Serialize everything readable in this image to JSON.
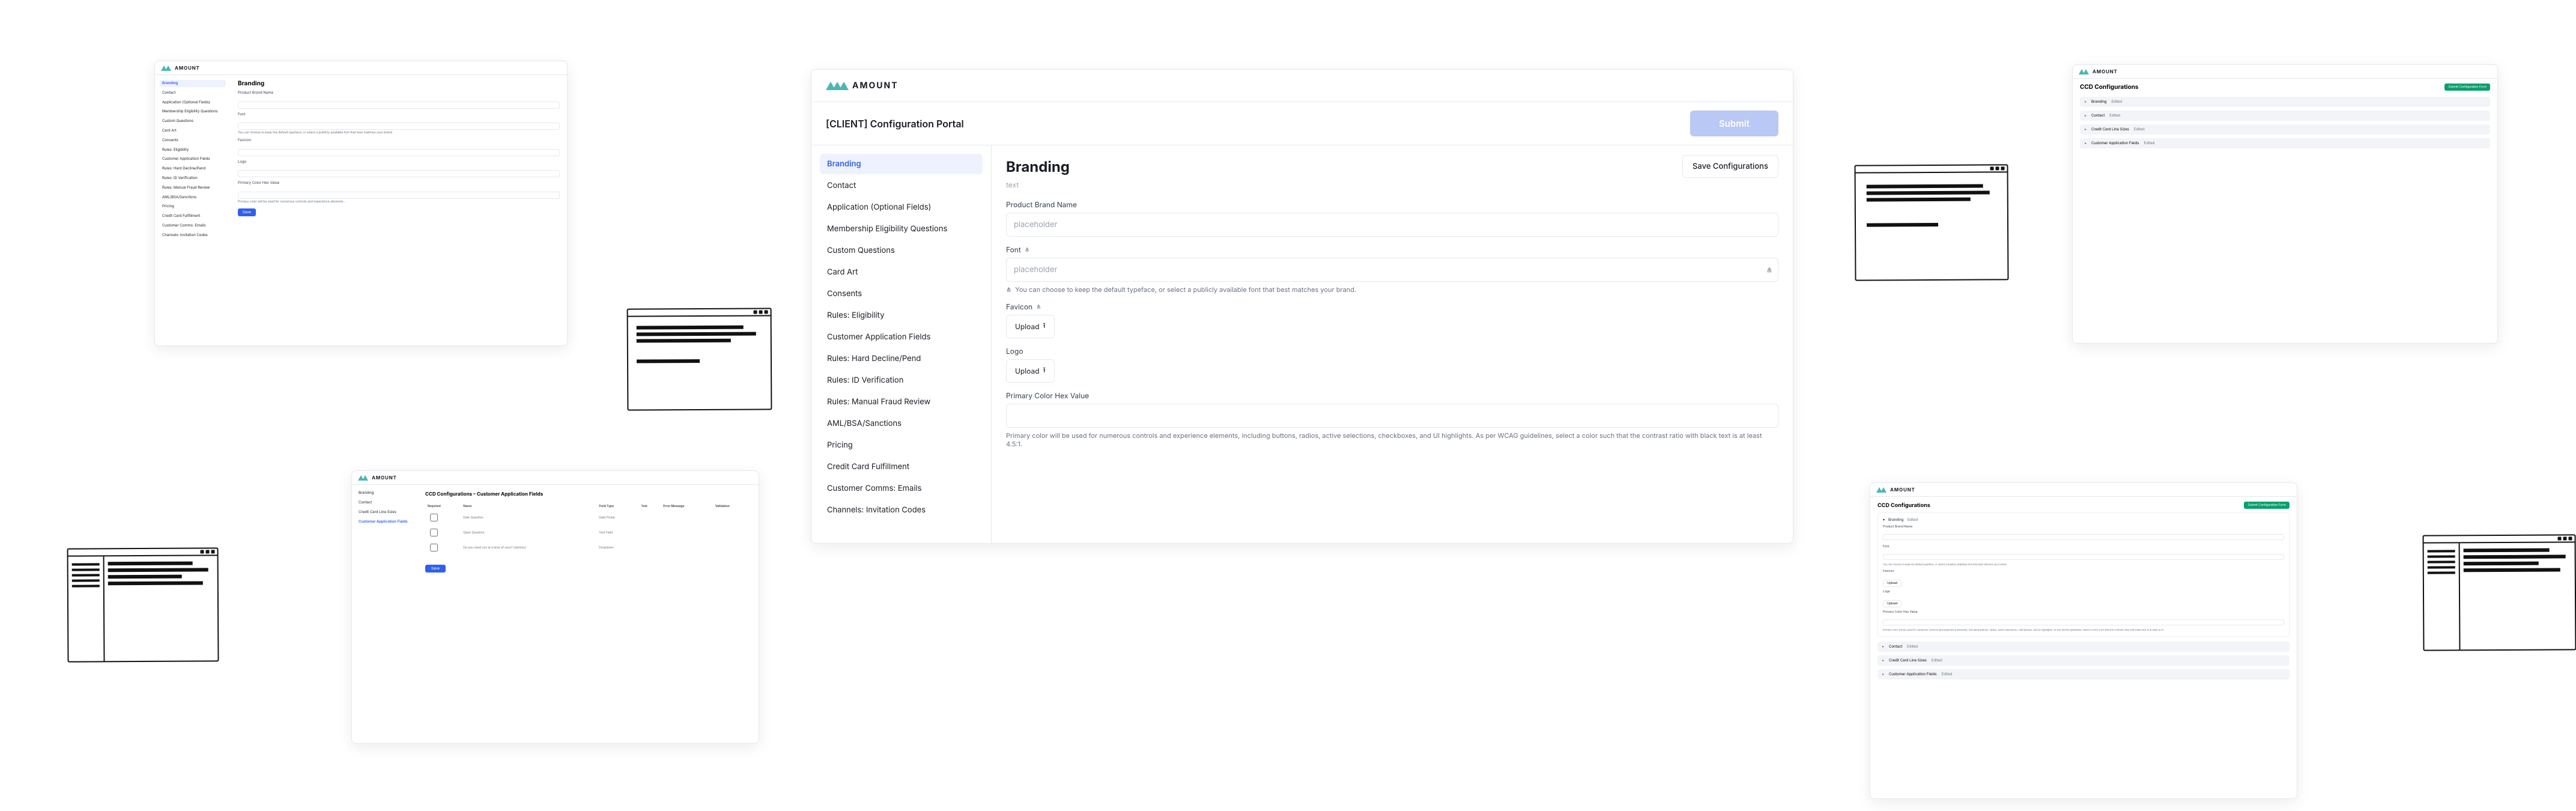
{
  "brand": "AMOUNT",
  "big": {
    "portal_title": "[CLIENT] Configuration Portal",
    "submit": "Submit",
    "nav": [
      "Branding",
      "Contact",
      "Application (Optional Fields)",
      "Membership Eligibility Questions",
      "Custom Questions",
      "Card Art",
      "Consents",
      "Rules: Eligibility",
      "Customer Application Fields",
      "Rules: Hard Decline/Pend",
      "Rules: ID Verification",
      "Rules: Manual Fraud Review",
      "AML/BSA/Sanctions",
      "Pricing",
      "Credit Card Fulfillment",
      "Customer Comms: Emails",
      "Channels: Invitation Codes"
    ],
    "section": {
      "heading": "Branding",
      "sub": "text",
      "save": "Save Configurations",
      "productBrand": {
        "label": "Product Brand Name",
        "placeholder": "placeholder"
      },
      "font": {
        "label": "Font",
        "placeholder": "placeholder",
        "hint": "You can choose to keep the default typeface, or select a publicly available font that best matches your brand."
      },
      "favicon": {
        "label": "Favicon",
        "upload": "Upload"
      },
      "logo": {
        "label": "Logo",
        "upload": "Upload"
      },
      "primary": {
        "label": "Primary Color Hex Value",
        "hint": "Primary color will be used for numerous controls and experience elements, including buttons, radios, active selections, checkboxes, and UI highlights. As per WCAG guidelines, select a color such that the contrast ratio with black text is at least 4.5:1."
      }
    }
  },
  "a": {
    "nav": [
      "Branding",
      "Contact",
      "Application (Optional Fields)",
      "Membership Eligibility Questions",
      "Custom Questions",
      "Card Art",
      "Consents",
      "Rules: Eligibility",
      "Customer Application Fields",
      "Rules: Hard Decline/Pend",
      "Rules: ID Verification",
      "Rules: Manual Fraud Review",
      "AML/BSA/Sanctions",
      "Pricing",
      "Credit Card Fulfillment",
      "Customer Comms: Emails",
      "Channels: Invitation Codes"
    ],
    "heading": "Branding",
    "labels": {
      "productBrand": "Product Brand Name",
      "font": "Font",
      "favicon": "Favicon",
      "logo": "Logo",
      "primary": "Primary Color Hex Value"
    },
    "save": "Save"
  },
  "b": {
    "nav": [
      "Branding",
      "Contact",
      "Credit Card Line Sizes",
      "Customer Application Fields"
    ],
    "title": "CCD Configurations – Customer Application Fields",
    "cols": [
      "Required",
      "Name",
      "Field Type",
      "Test",
      "Error Message",
      "Validation"
    ],
    "rows": [
      {
        "name": "Date Question",
        "type": "Date Picker"
      },
      {
        "name": "Open Question",
        "type": "Text Field"
      },
      {
        "name": "Do you need xxx at a time of xxxx? (dummy)",
        "type": "Dropdown"
      }
    ],
    "save": "Save"
  },
  "c": {
    "title": "CCD Configurations",
    "btn": "Submit Configuration Form",
    "rows": [
      {
        "name": "Branding",
        "status": "Edited"
      },
      {
        "name": "Contact",
        "status": "Edited"
      },
      {
        "name": "Credit Card Line Sizes",
        "status": "Edited"
      },
      {
        "name": "Customer Application Fields",
        "status": "Edited"
      }
    ]
  },
  "d": {
    "title": "CCD Configurations",
    "btn": "Submit Configuration Form",
    "open": {
      "name": "Branding",
      "status": "Edited",
      "labels": {
        "productBrand": "Product Brand Name",
        "font": "Font",
        "fontHint": "You can choose to keep the default typeface, or select a publicly available font that best matches your brand.",
        "favicon": "Favicon",
        "logo": "Logo",
        "upload": "Upload",
        "primary": "Primary Color Hex Value",
        "primaryHint": "Primary color will be used for numerous controls and experience elements, including buttons, radios, active selections, checkboxes, and UI highlights. As per WCAG guidelines, select a color such that the contrast ratio with black text is at least 4.5:1."
      }
    },
    "rows": [
      {
        "name": "Contact",
        "status": "Edited"
      },
      {
        "name": "Credit Card Line Sizes",
        "status": "Edited"
      },
      {
        "name": "Customer Application Fields",
        "status": "Edited"
      }
    ]
  }
}
